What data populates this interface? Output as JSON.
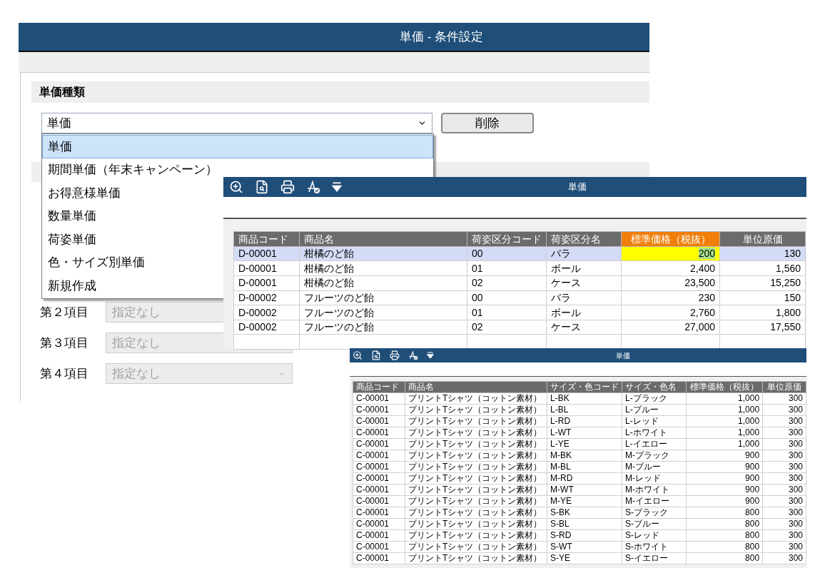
{
  "settings_window": {
    "title": "単価 - 条件設定",
    "section_title": "単価種類",
    "select": {
      "value": "単価",
      "expanded": true,
      "options": [
        {
          "label": "単価",
          "selected": true
        },
        {
          "label": "期間単価（年末キャンペーン）",
          "selected": false
        },
        {
          "label": "お得意様単価",
          "selected": false
        },
        {
          "label": "数量単価",
          "selected": false
        },
        {
          "label": "荷姿単価",
          "selected": false
        },
        {
          "label": "色・サイズ別単価",
          "selected": false
        },
        {
          "label": "新規作成",
          "selected": false
        }
      ]
    },
    "delete_button": "削除",
    "fields": [
      {
        "label": "第２項目",
        "value": "指定なし",
        "disabled": true
      },
      {
        "label": "第３項目",
        "value": "指定なし",
        "disabled": true
      },
      {
        "label": "第４項目",
        "value": "指定なし",
        "disabled": true
      }
    ]
  },
  "packaging_window": {
    "title": "単価",
    "table": {
      "columns": [
        {
          "label": "商品コード",
          "numeric": false,
          "highlighted": false
        },
        {
          "label": "商品名",
          "numeric": false,
          "highlighted": false
        },
        {
          "label": "荷姿区分コード",
          "numeric": false,
          "highlighted": false
        },
        {
          "label": "荷姿区分名",
          "numeric": false,
          "highlighted": false
        },
        {
          "label": "標準価格（税抜）",
          "numeric": true,
          "highlighted": true
        },
        {
          "label": "単位原価",
          "numeric": true,
          "highlighted": false
        }
      ],
      "rows": [
        {
          "selected": true,
          "cells": [
            "D-00001",
            "柑橘のど飴",
            "00",
            "バラ",
            "200",
            "130"
          ]
        },
        {
          "selected": false,
          "cells": [
            "D-00001",
            "柑橘のど飴",
            "01",
            "ボール",
            "2,400",
            "1,560"
          ]
        },
        {
          "selected": false,
          "cells": [
            "D-00001",
            "柑橘のど飴",
            "02",
            "ケース",
            "23,500",
            "15,250"
          ]
        },
        {
          "selected": false,
          "cells": [
            "D-00002",
            "フルーツのど飴",
            "00",
            "バラ",
            "230",
            "150"
          ]
        },
        {
          "selected": false,
          "cells": [
            "D-00002",
            "フルーツのど飴",
            "01",
            "ボール",
            "2,760",
            "1,800"
          ]
        },
        {
          "selected": false,
          "cells": [
            "D-00002",
            "フルーツのど飴",
            "02",
            "ケース",
            "27,000",
            "17,550"
          ]
        }
      ]
    }
  },
  "size_color_window": {
    "title": "単価",
    "table": {
      "columns": [
        {
          "label": "商品コード",
          "numeric": false,
          "highlighted": false
        },
        {
          "label": "商品名",
          "numeric": false,
          "highlighted": false
        },
        {
          "label": "サイズ・色コード",
          "numeric": false,
          "highlighted": false
        },
        {
          "label": "サイズ・色名",
          "numeric": false,
          "highlighted": false
        },
        {
          "label": "標準価格（税抜）",
          "numeric": true,
          "highlighted": false
        },
        {
          "label": "単位原価",
          "numeric": true,
          "highlighted": false
        }
      ],
      "rows": [
        {
          "selected": false,
          "cells": [
            "C-00001",
            "プリントTシャツ（コットン素材）",
            "L-BK",
            "L-ブラック",
            "1,000",
            "300"
          ]
        },
        {
          "selected": false,
          "cells": [
            "C-00001",
            "プリントTシャツ（コットン素材）",
            "L-BL",
            "L-ブルー",
            "1,000",
            "300"
          ]
        },
        {
          "selected": false,
          "cells": [
            "C-00001",
            "プリントTシャツ（コットン素材）",
            "L-RD",
            "L-レッド",
            "1,000",
            "300"
          ]
        },
        {
          "selected": false,
          "cells": [
            "C-00001",
            "プリントTシャツ（コットン素材）",
            "L-WT",
            "L-ホワイト",
            "1,000",
            "300"
          ]
        },
        {
          "selected": false,
          "cells": [
            "C-00001",
            "プリントTシャツ（コットン素材）",
            "L-YE",
            "L-イエロー",
            "1,000",
            "300"
          ]
        },
        {
          "selected": false,
          "cells": [
            "C-00001",
            "プリントTシャツ（コットン素材）",
            "M-BK",
            "M-ブラック",
            "900",
            "300"
          ]
        },
        {
          "selected": false,
          "cells": [
            "C-00001",
            "プリントTシャツ（コットン素材）",
            "M-BL",
            "M-ブルー",
            "900",
            "300"
          ]
        },
        {
          "selected": false,
          "cells": [
            "C-00001",
            "プリントTシャツ（コットン素材）",
            "M-RD",
            "M-レッド",
            "900",
            "300"
          ]
        },
        {
          "selected": false,
          "cells": [
            "C-00001",
            "プリントTシャツ（コットン素材）",
            "M-WT",
            "M-ホワイト",
            "900",
            "300"
          ]
        },
        {
          "selected": false,
          "cells": [
            "C-00001",
            "プリントTシャツ（コットン素材）",
            "M-YE",
            "M-イエロー",
            "900",
            "300"
          ]
        },
        {
          "selected": false,
          "cells": [
            "C-00001",
            "プリントTシャツ（コットン素材）",
            "S-BK",
            "S-ブラック",
            "800",
            "300"
          ]
        },
        {
          "selected": false,
          "cells": [
            "C-00001",
            "プリントTシャツ（コットン素材）",
            "S-BL",
            "S-ブルー",
            "800",
            "300"
          ]
        },
        {
          "selected": false,
          "cells": [
            "C-00001",
            "プリントTシャツ（コットン素材）",
            "S-RD",
            "S-レッド",
            "800",
            "300"
          ]
        },
        {
          "selected": false,
          "cells": [
            "C-00001",
            "プリントTシャツ（コットン素材）",
            "S-WT",
            "S-ホワイト",
            "800",
            "300"
          ]
        },
        {
          "selected": false,
          "cells": [
            "C-00001",
            "プリントTシャツ（コットン素材）",
            "S-YE",
            "S-イエロー",
            "800",
            "300"
          ]
        }
      ]
    }
  }
}
